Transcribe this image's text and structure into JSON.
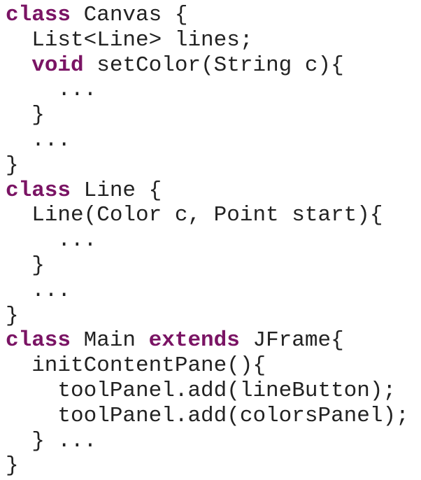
{
  "document": {
    "lines": [
      [
        {
          "t": "class",
          "kw": true
        },
        {
          "t": " Canvas {"
        }
      ],
      [
        {
          "t": "  List<Line> lines;"
        }
      ],
      [
        {
          "t": "  "
        },
        {
          "t": "void",
          "kw": true
        },
        {
          "t": " setColor(String c){"
        }
      ],
      [
        {
          "t": "    ..."
        }
      ],
      [
        {
          "t": "  }"
        }
      ],
      [
        {
          "t": "  ..."
        }
      ],
      [
        {
          "t": "}"
        }
      ],
      [
        {
          "t": "class",
          "kw": true
        },
        {
          "t": " Line {"
        }
      ],
      [
        {
          "t": "  Line(Color c, Point start){"
        }
      ],
      [
        {
          "t": "    ..."
        }
      ],
      [
        {
          "t": "  }"
        }
      ],
      [
        {
          "t": "  ..."
        }
      ],
      [
        {
          "t": "}"
        }
      ],
      [
        {
          "t": "class",
          "kw": true
        },
        {
          "t": " Main "
        },
        {
          "t": "extends",
          "kw": true
        },
        {
          "t": " JFrame{"
        }
      ],
      [
        {
          "t": "  initContentPane(){"
        }
      ],
      [
        {
          "t": "    toolPanel.add(lineButton);"
        }
      ],
      [
        {
          "t": "    toolPanel.add(colorsPanel);"
        }
      ],
      [
        {
          "t": "  } ..."
        }
      ],
      [
        {
          "t": "}"
        }
      ]
    ]
  },
  "colors": {
    "keyword": "#7a1464",
    "text": "#222222",
    "background": "#ffffff"
  }
}
